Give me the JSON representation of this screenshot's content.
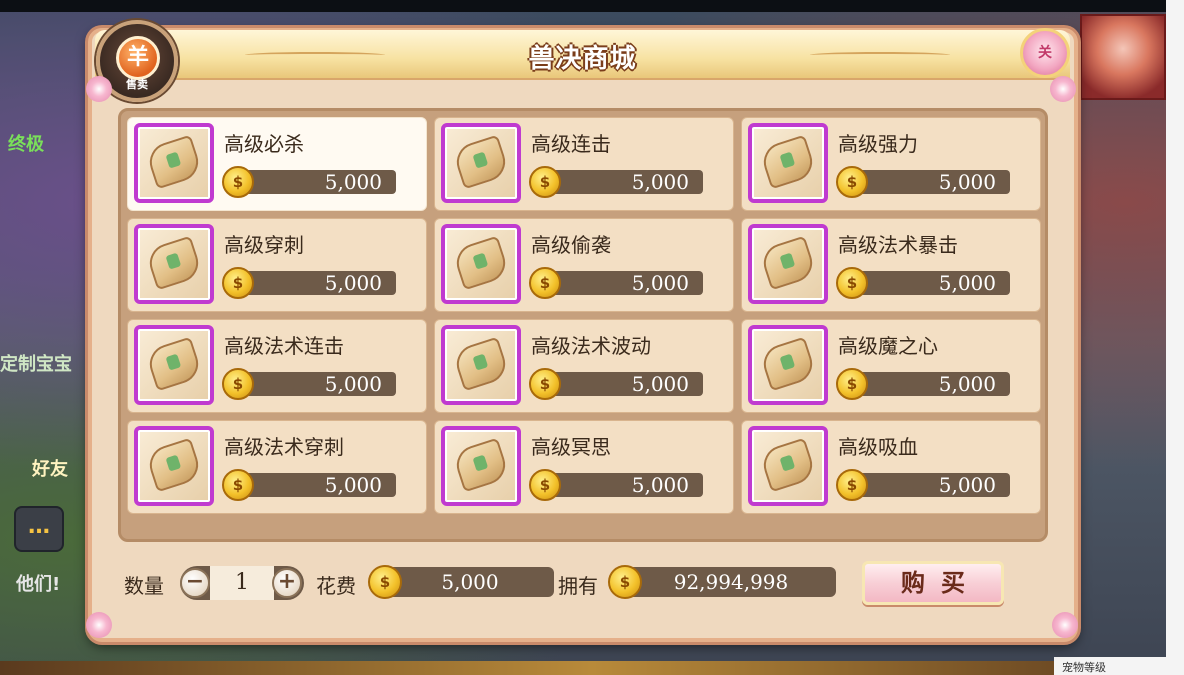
{
  "window": {
    "title": "兽决商城",
    "sell_badge": {
      "glyph": "羊",
      "label": "售卖"
    },
    "close_label": "关"
  },
  "items": [
    {
      "name": "高级必杀",
      "price": "5,000",
      "selected": true
    },
    {
      "name": "高级连击",
      "price": "5,000"
    },
    {
      "name": "高级强力",
      "price": "5,000"
    },
    {
      "name": "高级穿刺",
      "price": "5,000"
    },
    {
      "name": "高级偷袭",
      "price": "5,000"
    },
    {
      "name": "高级法术暴击",
      "price": "5,000"
    },
    {
      "name": "高级法术连击",
      "price": "5,000"
    },
    {
      "name": "高级法术波动",
      "price": "5,000"
    },
    {
      "name": "高级魔之心",
      "price": "5,000"
    },
    {
      "name": "高级法术穿刺",
      "price": "5,000"
    },
    {
      "name": "高级冥思",
      "price": "5,000"
    },
    {
      "name": "高级吸血",
      "price": "5,000"
    }
  ],
  "footer": {
    "quantity_label": "数量",
    "quantity_value": "1",
    "minus_label": "−",
    "plus_label": "+",
    "cost_label": "花费",
    "cost_value": "5,000",
    "owned_label": "拥有",
    "owned_value": "92,994,998",
    "buy_label": "购买",
    "coin_glyph": "$"
  },
  "background": {
    "left_texts": [
      "终极",
      "定制宝宝",
      "好友",
      "他们!"
    ],
    "bottom_right_text": "宠物等级"
  },
  "colors": {
    "frame": "#efd9bf",
    "item_border": "#c03ad0",
    "price_bar": "#6e5a48",
    "title_outline": "#7a3d1a"
  }
}
